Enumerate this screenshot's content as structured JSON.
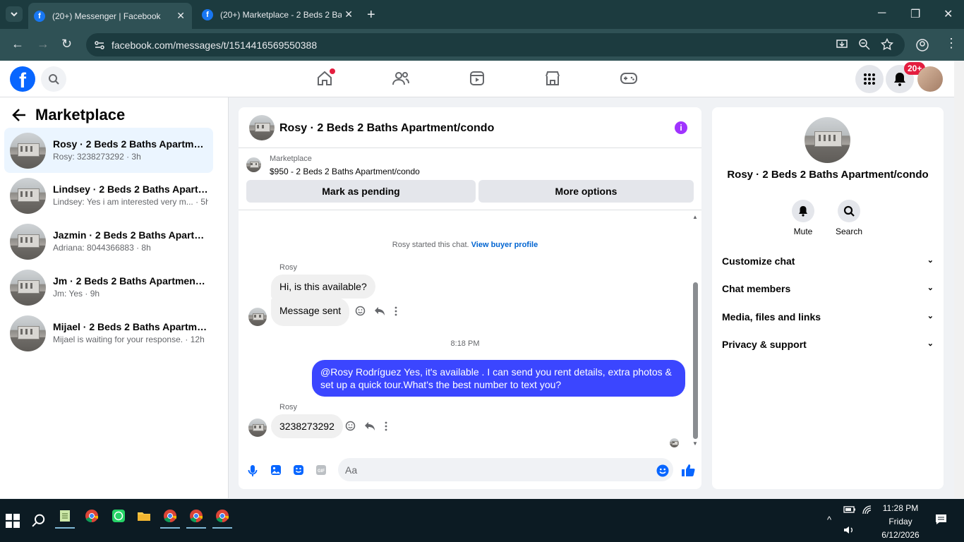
{
  "browser": {
    "tabs": [
      {
        "title": "(20+) Messenger | Facebook",
        "active": true
      },
      {
        "title": "(20+) Marketplace - 2 Beds 2 Ba",
        "active": false
      }
    ],
    "url": "facebook.com/messages/t/1514416569550388"
  },
  "header": {
    "logo": "f",
    "notification_badge": "20+"
  },
  "sidebar": {
    "title": "Marketplace",
    "conversations": [
      {
        "name": "Rosy · 2 Beds 2 Baths Apartmen...",
        "preview": "Rosy: 3238273292 · 3h",
        "active": true
      },
      {
        "name": "Lindsey · 2 Beds 2 Baths Apartm...",
        "preview": "Lindsey: Yes i am interested very m... · 5h",
        "active": false
      },
      {
        "name": "Jazmin · 2 Beds 2 Baths Apartm...",
        "preview": "Adriana: 8044366883 · 8h",
        "active": false
      },
      {
        "name": "Jm · 2 Beds 2 Baths Apartment/...",
        "preview": "Jm: Yes · 9h",
        "active": false
      },
      {
        "name": "Mijael · 2 Beds 2 Baths Apartme...",
        "preview": "Mijael is waiting for your response. · 12h",
        "active": false
      }
    ]
  },
  "chat": {
    "title": "Rosy · 2 Beds 2 Baths Apartment/condo",
    "marketplace_label": "Marketplace",
    "listing": "$950 - 2 Beds 2 Baths Apartment/condo",
    "mark_pending": "Mark as pending",
    "more_options": "More options",
    "started_text": "Rosy started this chat.",
    "buyer_profile_link": "View buyer profile",
    "sender1": "Rosy",
    "msg1": "Hi, is this available?",
    "msg2": "Message sent",
    "time": "8:18 PM",
    "outgoing": "@Rosy Rodríguez Yes, it's available .  I can send you rent details, extra photos & set up a quick tour.What's the best number to text you?",
    "sender2": "Rosy",
    "msg3": "3238273292",
    "input_placeholder": "Aa"
  },
  "rpanel": {
    "title": "Rosy · 2 Beds 2 Baths Apartment/condo",
    "mute": "Mute",
    "search": "Search",
    "sections": [
      "Customize chat",
      "Chat members",
      "Media, files and links",
      "Privacy & support"
    ]
  },
  "taskbar": {
    "time": "11:28 PM",
    "day": "Friday",
    "date": "6/12/2026"
  },
  "colors": {
    "fb_blue": "#0866ff",
    "outgoing_bubble": "#3b46ff",
    "info_purple": "#a033ff",
    "badge_red": "#e41e3f"
  }
}
